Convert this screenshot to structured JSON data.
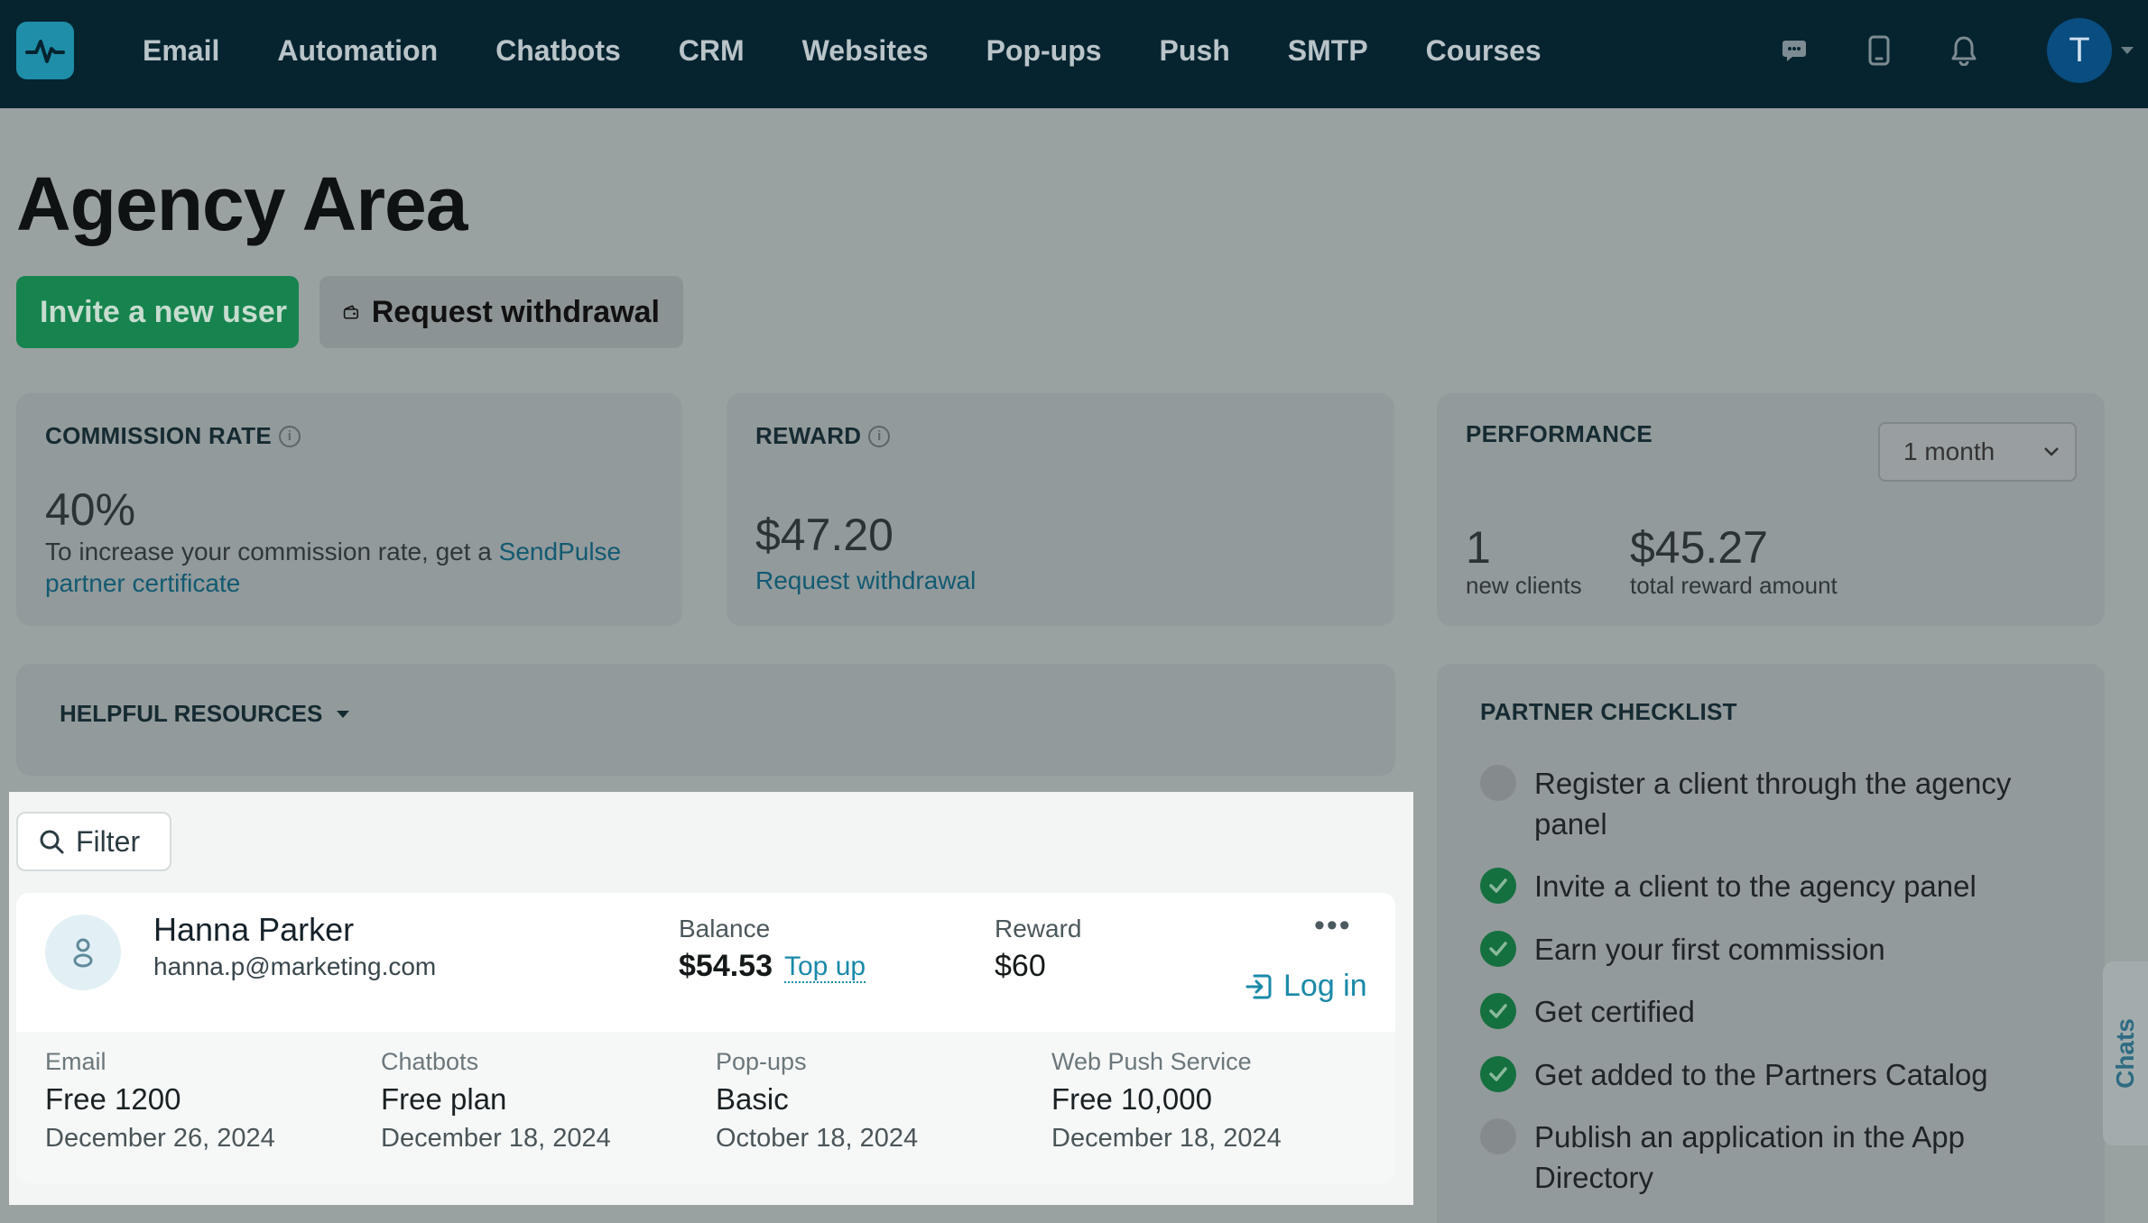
{
  "nav": {
    "items": [
      "Email",
      "Automation",
      "Chatbots",
      "CRM",
      "Websites",
      "Pop-ups",
      "Push",
      "SMTP",
      "Courses"
    ],
    "avatar_letter": "T"
  },
  "page": {
    "title": "Agency Area",
    "invite_button": "Invite a new user",
    "withdraw_button": "Request withdrawal"
  },
  "commission": {
    "label": "COMMISSION RATE",
    "value": "40%",
    "text": "To increase your commission rate, get a ",
    "link": "SendPulse partner certificate"
  },
  "reward": {
    "label": "REWARD",
    "value": "$47.20",
    "link": "Request withdrawal"
  },
  "performance": {
    "label": "PERFORMANCE",
    "period": "1 month",
    "new_clients_value": "1",
    "new_clients_label": "new clients",
    "total_value": "$45.27",
    "total_label": "total reward amount"
  },
  "resources": {
    "label": "HELPFUL RESOURCES"
  },
  "filter": {
    "label": "Filter"
  },
  "client": {
    "name": "Hanna Parker",
    "email": "hanna.p@marketing.com",
    "balance_label": "Balance",
    "balance_value": "$54.53",
    "topup_label": "Top up",
    "reward_label": "Reward",
    "reward_value": "$60",
    "more": "•••",
    "login_label": "Log in",
    "services": [
      {
        "name": "Email",
        "plan": "Free 1200",
        "date": "December 26, 2024"
      },
      {
        "name": "Chatbots",
        "plan": "Free plan",
        "date": "December 18, 2024"
      },
      {
        "name": "Pop-ups",
        "plan": "Basic",
        "date": "October 18, 2024"
      },
      {
        "name": "Web Push Service",
        "plan": "Free 10,000",
        "date": "December 18, 2024"
      }
    ]
  },
  "checklist": {
    "label": "PARTNER CHECKLIST",
    "items": [
      {
        "text": "Register a client through the agency panel",
        "done": false
      },
      {
        "text": "Invite a client to the agency panel",
        "done": true
      },
      {
        "text": "Earn your first commission",
        "done": true
      },
      {
        "text": "Get certified",
        "done": true
      },
      {
        "text": "Get added to the Partners Catalog",
        "done": true
      },
      {
        "text": "Publish an application in the App Directory",
        "done": false
      }
    ]
  },
  "chats_tab": "Chats"
}
